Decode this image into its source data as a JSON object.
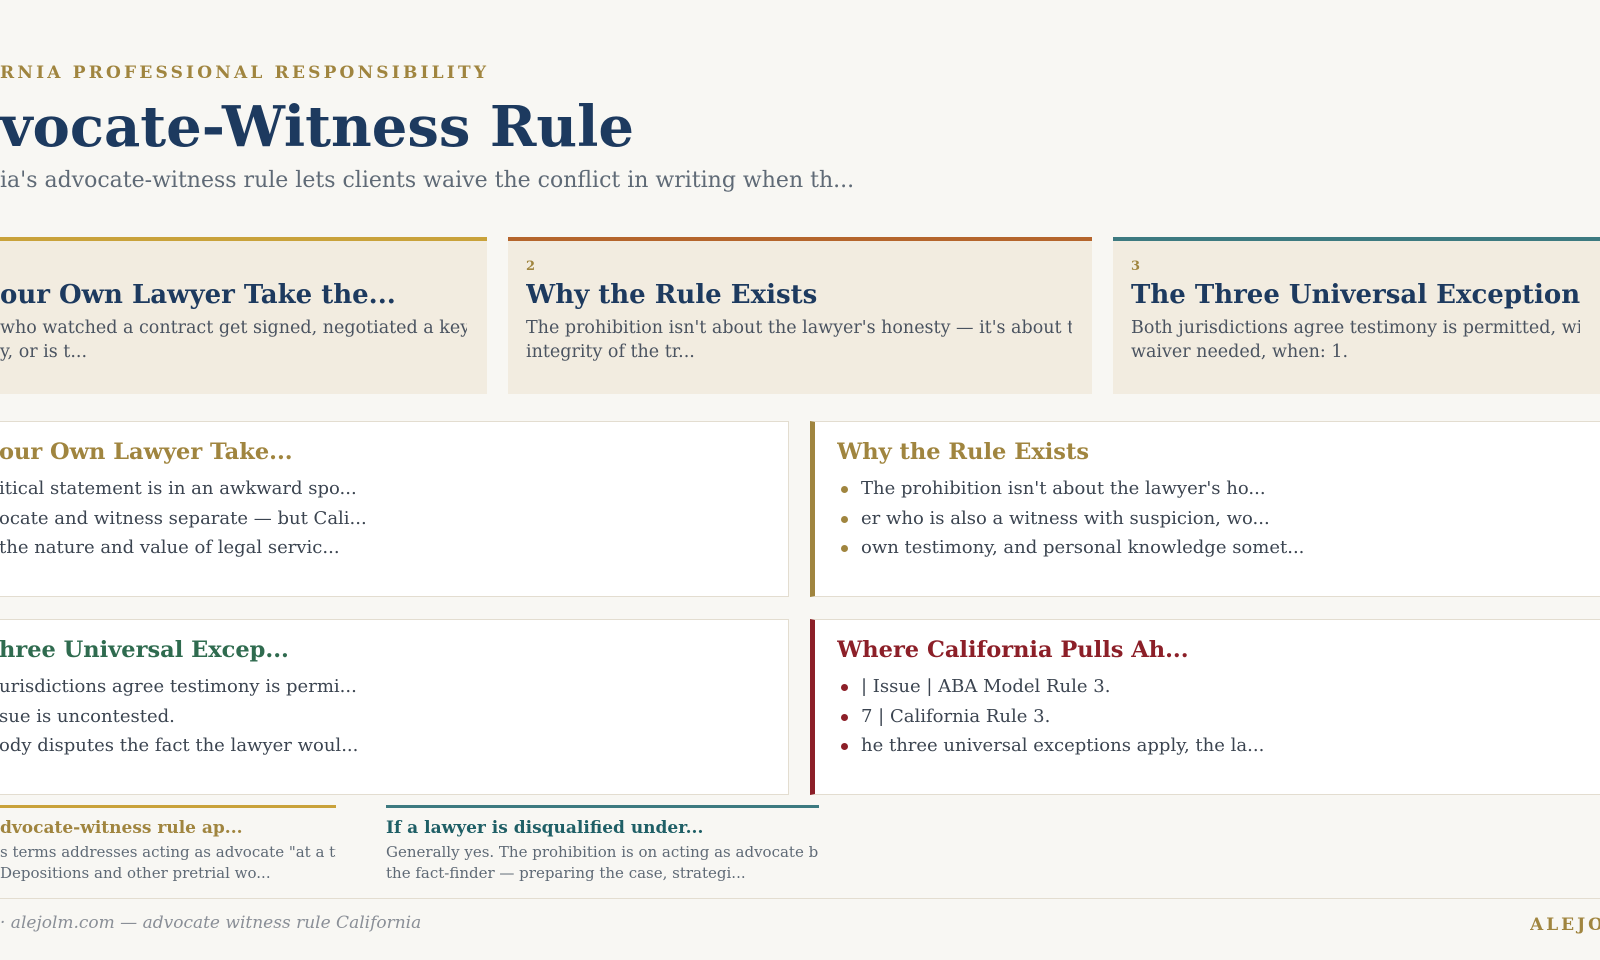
{
  "header": {
    "eyebrow": "RNIA PROFESSIONAL RESPONSIBILITY",
    "title": "vocate-Witness Rule",
    "subtitle": "ia's advocate-witness rule lets clients waive the conflict in writing when th..."
  },
  "cards": [
    {
      "number": "",
      "title": "our Own Lawyer Take the...",
      "desc": [
        "who watched a contract get signed, negotiated a key term",
        "y, or is t..."
      ],
      "accent": "#c9a23a"
    },
    {
      "number": "2",
      "title": "Why the Rule Exists",
      "desc": [
        "The prohibition isn't about the lawyer's honesty — it's about the",
        "integrity of the tr..."
      ],
      "accent": "#b5652c"
    },
    {
      "number": "3",
      "title": "The Three Universal Exceptions",
      "desc": [
        "Both jurisdictions agree testimony is permitted, without a",
        "waiver needed, when: 1."
      ],
      "accent": "#3d7a80"
    }
  ],
  "panels": [
    {
      "title": "our Own Lawyer Take...",
      "title_color": "#a0853f",
      "items": [
        "itical statement is in an awkward spo...",
        "ocate and witness separate — but Cali...",
        "the nature and value of legal servic..."
      ]
    },
    {
      "title": "Why the Rule Exists",
      "title_color": "#a0853f",
      "bullet_color": "#a0853f",
      "items": [
        "The prohibition isn't about the lawyer's ho...",
        "er who is also a witness with suspicion, wo...",
        "own testimony, and personal knowledge somet..."
      ]
    },
    {
      "title": "hree Universal Excep...",
      "title_color": "#2f6b4f",
      "items": [
        "urisdictions agree testimony is permi...",
        "sue is uncontested.",
        "ody disputes the fact the lawyer woul..."
      ]
    },
    {
      "title": "Where California Pulls Ah...",
      "title_color": "#8c1f28",
      "bullet_color": "#8c1f28",
      "items": [
        "| Issue | ABA Model Rule 3.",
        "7 | California Rule 3.",
        "he three universal exceptions apply, the la..."
      ]
    }
  ],
  "faqs": [
    {
      "question": "dvocate-witness rule ap...",
      "answer": [
        "s terms addresses acting as advocate \"at a trial",
        "Depositions and other pretrial wo..."
      ],
      "color": "#a0853f",
      "rule_color": "#c9a23a"
    },
    {
      "question": "If a lawyer is disqualified under...",
      "answer": [
        "Generally yes. The prohibition is on acting as advocate before",
        "the fact-finder — preparing the case, strategi..."
      ],
      "color": "#1f5f66",
      "rule_color": "#3d7a80"
    }
  ],
  "footer": {
    "left": "· alejolm.com — advocate witness rule California",
    "right": "ALEJO"
  }
}
